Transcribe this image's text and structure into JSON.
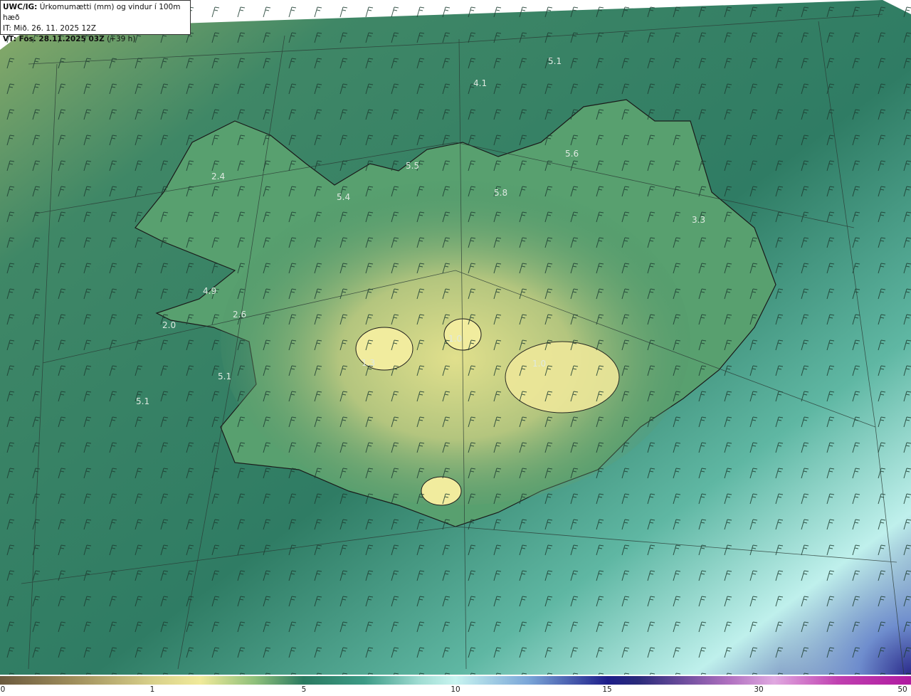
{
  "header": {
    "model": "UWC/IG:",
    "title": "Úrkomumætti (mm) og vindur í 100m hæð",
    "init_time": "IT: Mið. 26. 11. 2025 12Z",
    "valid_label": "VT: Fös. 28.11.2025 03Z",
    "lead": "(+39 h)"
  },
  "station_values": [
    "5.1",
    "4.1",
    "5.5",
    "5.6",
    "5.8",
    "2.4",
    "5.4",
    "3.3",
    "4.9",
    "2.6",
    "2.0",
    "1.0",
    "1.3",
    "1.0",
    "5.1",
    "5.1"
  ],
  "colorbar": {
    "ticks": [
      "0",
      "1",
      "5",
      "10",
      "15",
      "30",
      "50"
    ]
  },
  "colors": {
    "land_low": "#d9d98c",
    "land_mid": "#4f9a6c",
    "sea": "#2f7c64",
    "sea_light": "#9fe0d8",
    "heavy": "#2a2a8a"
  }
}
